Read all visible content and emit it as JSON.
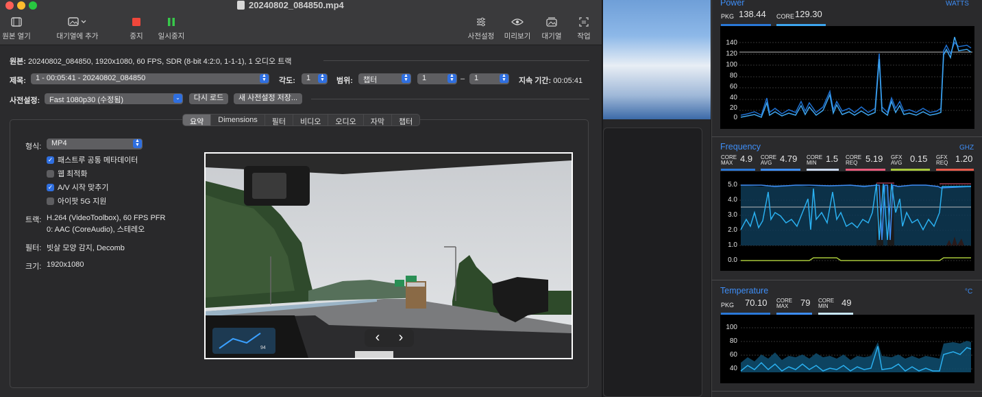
{
  "window": {
    "title": "20240802_084850.mp4",
    "colors": {
      "close": "#fe5f57",
      "minimize": "#febc2e",
      "maximize": "#28c840"
    }
  },
  "toolbar": {
    "open_source": "원본 열기",
    "add_to_queue": "대기열에 추가",
    "stop": "중지",
    "pause": "일시중지",
    "presets": "사전설정",
    "preview": "미리보기",
    "queue": "대기열",
    "activity": "작업"
  },
  "source": {
    "label": "원본:",
    "value": "20240802_084850, 1920x1080, 60 FPS, SDR (8-bit 4:2:0, 1-1-1), 1 오디오 트랙"
  },
  "title_row": {
    "title_label": "제목:",
    "title_value": "1 - 00:05:41 - 20240802_084850",
    "angle_label": "각도:",
    "angle_value": "1",
    "range_label": "범위:",
    "range_type": "챕터",
    "range_start": "1",
    "range_dash": "–",
    "range_end": "1",
    "duration_label": "지속 기간:",
    "duration_value": "00:05:41"
  },
  "preset_row": {
    "label": "사전설정:",
    "value": "Fast 1080p30 (수정됨)",
    "reload": "다시 로드",
    "save_new": "새 사전설정 저장..."
  },
  "tabs": [
    "요약",
    "Dimensions",
    "필터",
    "비디오",
    "오디오",
    "자막",
    "챕터"
  ],
  "summary": {
    "format_label": "형식:",
    "format_value": "MP4",
    "options": [
      {
        "label": "패스트루 공통 메타데이터",
        "checked": true
      },
      {
        "label": "웹 최적화",
        "checked": false
      },
      {
        "label": "A/V 시작 맞추기",
        "checked": true
      },
      {
        "label": "아이팟 5G 지원",
        "checked": false
      }
    ],
    "tracks_label": "트랙:",
    "tracks_line1": "H.264 (VideoToolbox), 60 FPS PFR",
    "tracks_line2": "0: AAC (CoreAudio), 스테레오",
    "filters_label": "필터:",
    "filters_value": "빗살 모양 감지, Decomb",
    "size_label": "크기:",
    "size_value": "1920x1080"
  },
  "preview_nav": {
    "prev": "‹",
    "next": "›",
    "dash_speed": "94"
  },
  "stats": {
    "power": {
      "title": "Power",
      "unit": "WATTS",
      "pkg_label": "PKG",
      "pkg_value": "138.44",
      "core_label": "CORE",
      "core_value": "129.30",
      "yticks": [
        "140",
        "120",
        "100",
        "80",
        "60",
        "40",
        "20",
        "0"
      ]
    },
    "frequency": {
      "title": "Frequency",
      "unit": "GHZ",
      "metrics": [
        {
          "top": "CORE",
          "bottom": "MAX",
          "value": "4.9",
          "color": "#3e8ef7"
        },
        {
          "top": "CORE",
          "bottom": "AVG",
          "value": "4.79",
          "color": "#3e8ef7"
        },
        {
          "top": "CORE",
          "bottom": "MIN",
          "value": "1.5",
          "color": "#c8d8f0"
        },
        {
          "top": "CORE",
          "bottom": "REQ",
          "value": "5.19",
          "color": "#e85a7a"
        },
        {
          "top": "GFX",
          "bottom": "AVG",
          "value": "0.15",
          "color": "#a8c83a"
        },
        {
          "top": "GFX",
          "bottom": "REQ",
          "value": "1.20",
          "color": "#e85a4a"
        }
      ],
      "yticks": [
        "5.0",
        "4.0",
        "3.0",
        "2.0",
        "1.0",
        "0.0"
      ]
    },
    "temperature": {
      "title": "Temperature",
      "unit": "°C",
      "pkg_label": "PKG",
      "pkg_value": "70.10",
      "max_top": "CORE",
      "max_bottom": "MAX",
      "max_value": "79",
      "min_top": "CORE",
      "min_bottom": "MIN",
      "min_value": "49",
      "yticks": [
        "100",
        "80",
        "60",
        "40"
      ]
    }
  }
}
